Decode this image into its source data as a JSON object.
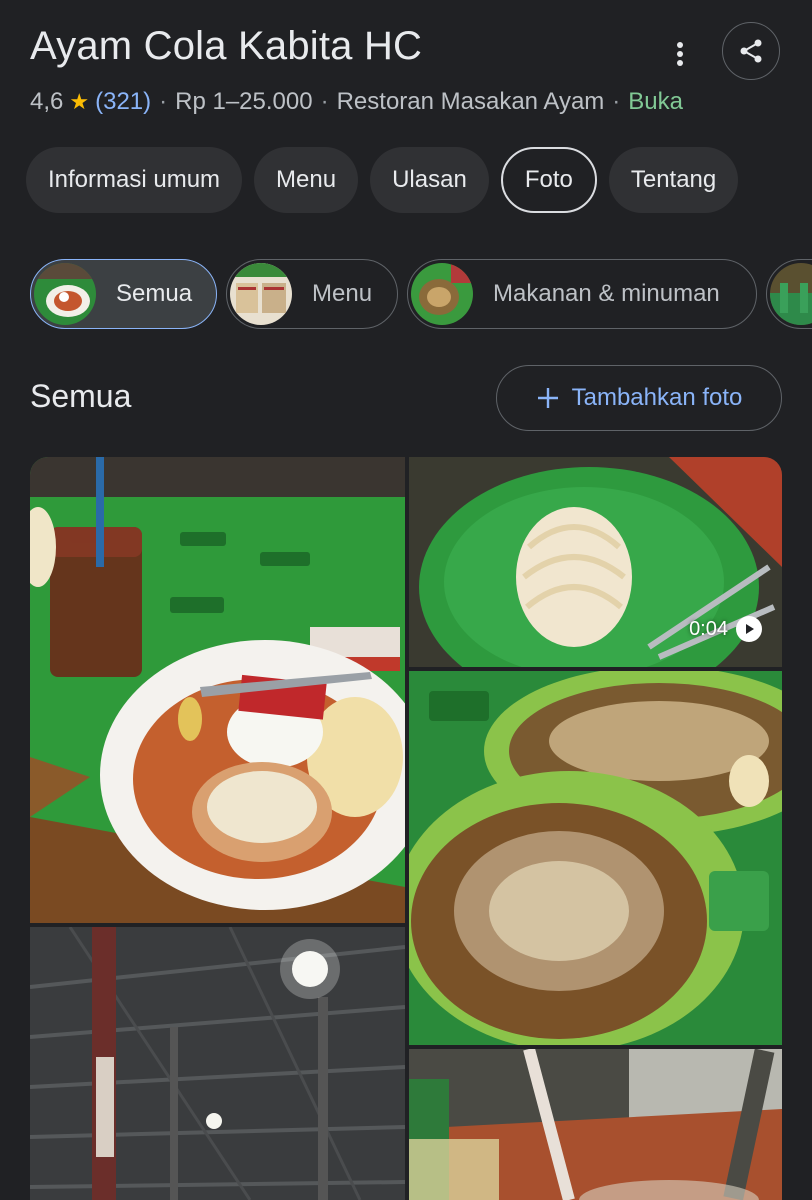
{
  "place": {
    "name": "Ayam Cola Kabita HC",
    "rating": "4,6",
    "review_count": "(321)",
    "price": "Rp 1–25.000",
    "category": "Restoran Masakan Ayam",
    "status": "Buka",
    "separator": "·"
  },
  "tabs": [
    {
      "label": "Informasi umum"
    },
    {
      "label": "Menu"
    },
    {
      "label": "Ulasan"
    },
    {
      "label": "Foto",
      "selected": true
    },
    {
      "label": "Tentang"
    }
  ],
  "filters": [
    {
      "label": "Semua",
      "selected": true
    },
    {
      "label": "Menu"
    },
    {
      "label": "Makanan & minuman"
    }
  ],
  "section": {
    "title": "Semua",
    "add_photo_label": "Tambahkan foto"
  },
  "video": {
    "duration": "0:04"
  },
  "colors": {
    "background": "#202124",
    "accent": "#8ab4f8",
    "open_status": "#81c995",
    "star": "#fbbc04"
  }
}
